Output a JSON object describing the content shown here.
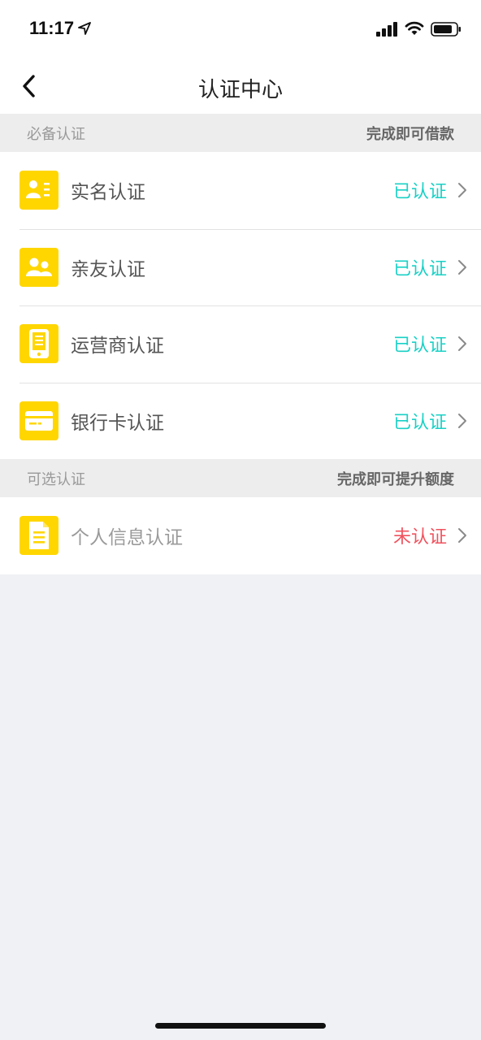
{
  "status_bar": {
    "time": "11:17",
    "icons": [
      "location-arrow-icon",
      "signal-bars-icon",
      "wifi-icon",
      "battery-icon"
    ]
  },
  "nav": {
    "title": "认证中心",
    "back_icon": "chevron-left-icon"
  },
  "colors": {
    "accent_yellow": "#FFD600",
    "verified": "#19D1C6",
    "unverified": "#F0525E",
    "page_bg": "#F0F1F4",
    "section_bg": "#EDEDED"
  },
  "required_section": {
    "title": "必备认证",
    "note": "完成即可借款",
    "items": [
      {
        "label": "实名认证",
        "status": "已认证",
        "icon": "id-card-icon"
      },
      {
        "label": "亲友认证",
        "status": "已认证",
        "icon": "contacts-icon"
      },
      {
        "label": "运营商认证",
        "status": "已认证",
        "icon": "phone-icon"
      },
      {
        "label": "银行卡认证",
        "status": "已认证",
        "icon": "bank-card-icon"
      }
    ]
  },
  "optional_section": {
    "title": "可选认证",
    "note": "完成即可提升额度",
    "items": [
      {
        "label": "个人信息认证",
        "status": "未认证",
        "icon": "document-icon"
      }
    ]
  }
}
